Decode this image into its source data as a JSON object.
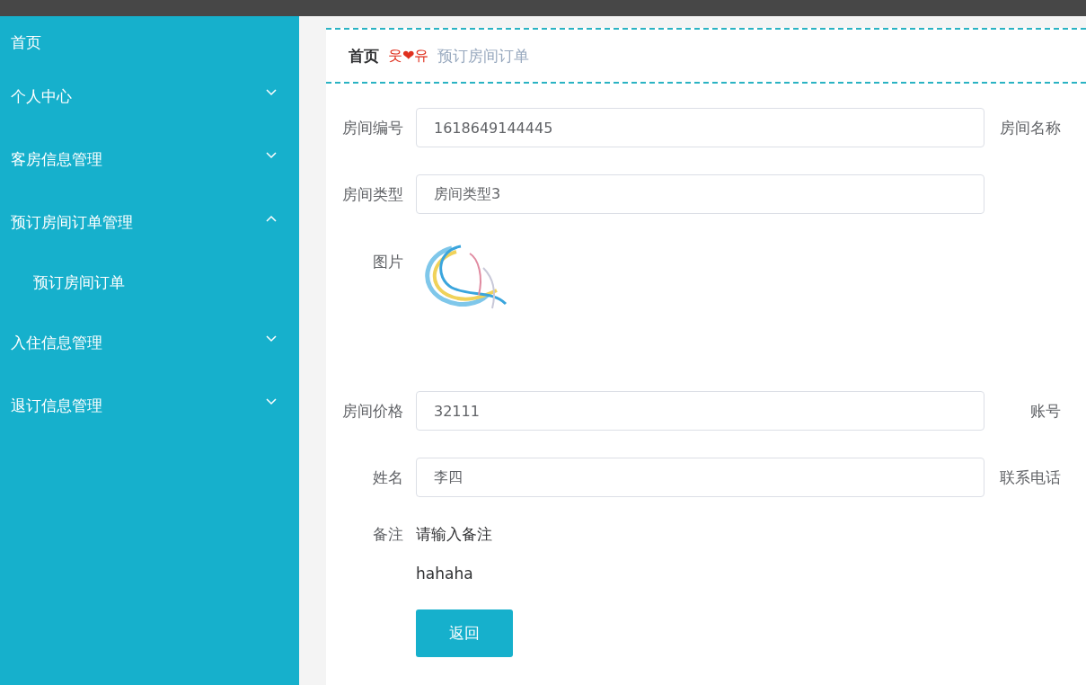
{
  "sidebar": {
    "items": [
      {
        "label": "首页"
      },
      {
        "label": "个人中心",
        "expanded": false
      },
      {
        "label": "客房信息管理",
        "expanded": false
      },
      {
        "label": "预订房间订单管理",
        "expanded": true,
        "children": [
          {
            "label": "预订房间订单"
          }
        ]
      },
      {
        "label": "入住信息管理",
        "expanded": false
      },
      {
        "label": "退订信息管理",
        "expanded": false
      }
    ]
  },
  "breadcrumb": {
    "home": "首页",
    "separator": "웃❤유",
    "current": "预订房间订单"
  },
  "form": {
    "rows": [
      {
        "kind": "input",
        "label": "房间编号",
        "value": "1618649144445",
        "side_label": "房间名称"
      },
      {
        "kind": "input",
        "label": "房间类型",
        "value": "房间类型3"
      },
      {
        "kind": "image",
        "label": "图片"
      },
      {
        "kind": "input",
        "label": "房间价格",
        "value": "32111",
        "side_label": "账号"
      },
      {
        "kind": "input",
        "label": "姓名",
        "value": "李四",
        "side_label": "联系电话"
      },
      {
        "kind": "remark",
        "label": "备注",
        "prompt": "请输入备注",
        "value": "hahaha"
      }
    ],
    "button": "返回"
  }
}
